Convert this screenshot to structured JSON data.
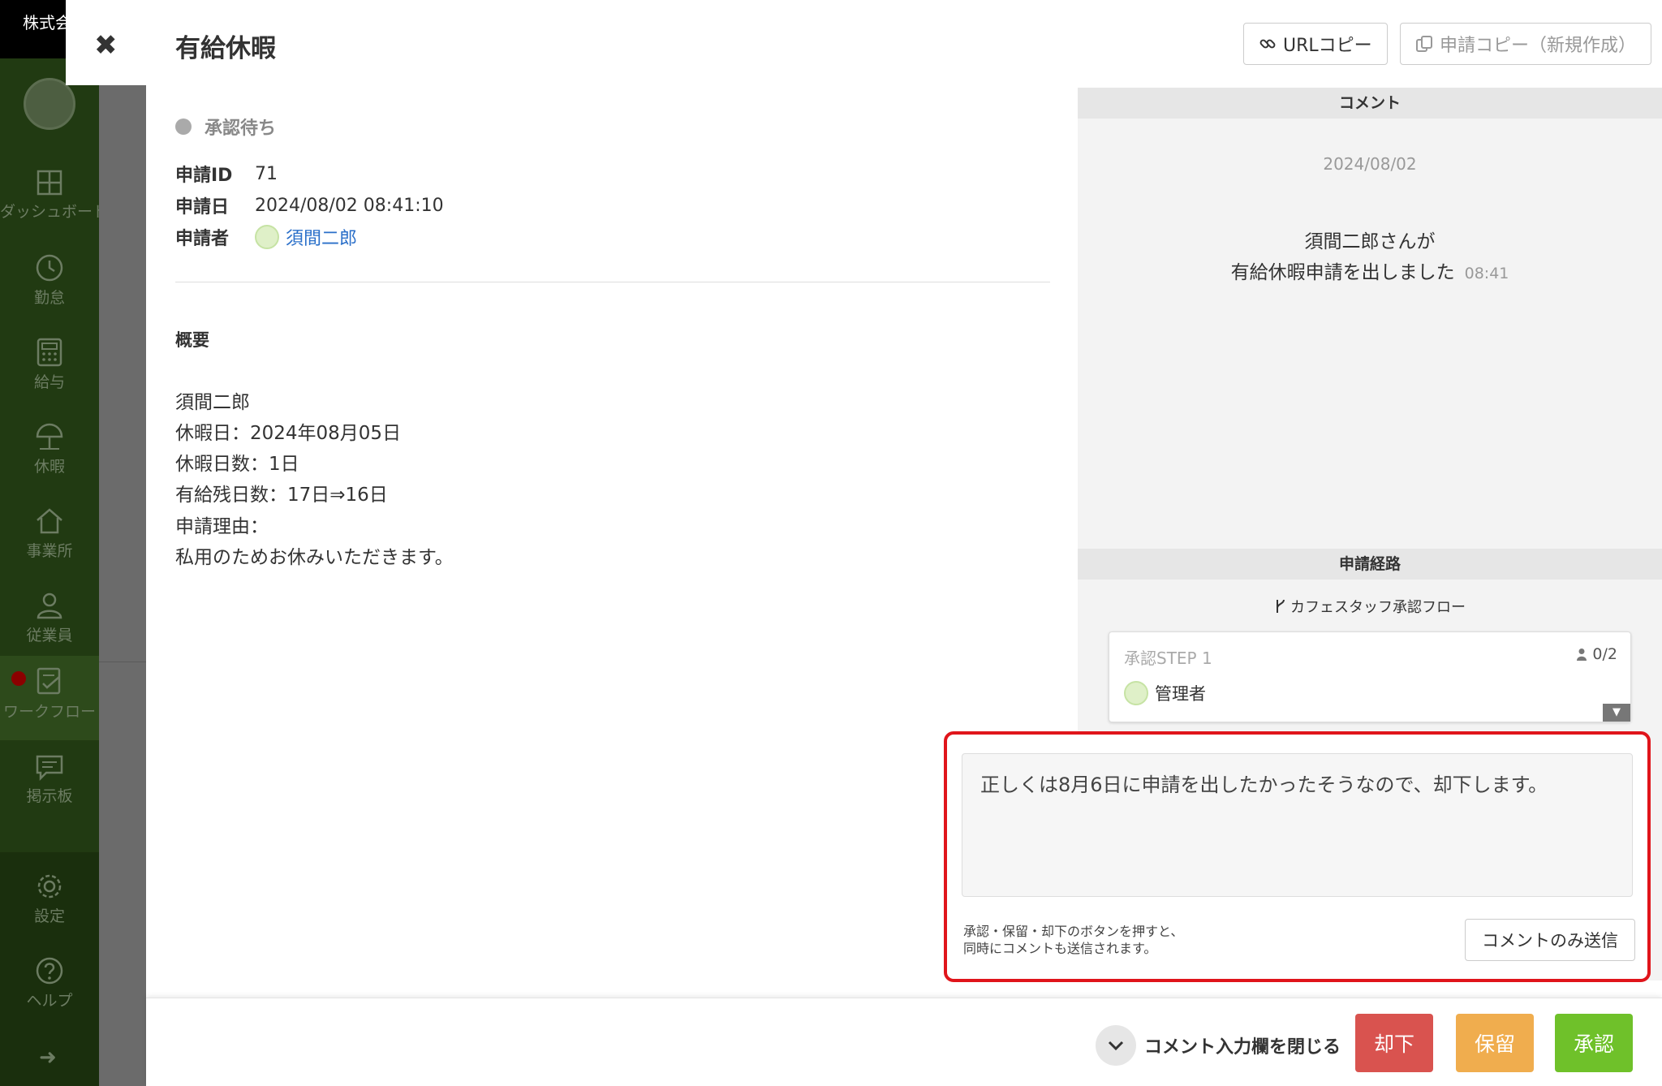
{
  "sidebar": {
    "company": "株式会",
    "items": [
      {
        "label": "ダッシュボード",
        "icon": "dashboard-icon"
      },
      {
        "label": "勤怠",
        "icon": "clock-icon"
      },
      {
        "label": "給与",
        "icon": "calculator-icon"
      },
      {
        "label": "休暇",
        "icon": "umbrella-icon"
      },
      {
        "label": "事業所",
        "icon": "home-icon"
      },
      {
        "label": "従業員",
        "icon": "person-icon"
      },
      {
        "label": "ワークフロー",
        "icon": "checklist-icon"
      },
      {
        "label": "掲示板",
        "icon": "chat-icon"
      },
      {
        "label": "設定",
        "icon": "gear-icon"
      },
      {
        "label": "ヘルプ",
        "icon": "question-icon"
      }
    ],
    "expand_arrow": "➜"
  },
  "modal": {
    "close_glyph": "✖",
    "title": "有給休暇",
    "url_copy_label": "URLコピー",
    "request_copy_label": "申請コピー（新規作成）"
  },
  "detail": {
    "status": "承認待ち",
    "fields": [
      {
        "key": "申請ID",
        "value": "71"
      },
      {
        "key": "申請日",
        "value": "2024/08/02 08:41:10"
      },
      {
        "key": "申請者",
        "value": "須間二郎"
      }
    ],
    "summary_title": "概要",
    "summary_lines": [
      "須間二郎",
      "休暇日：2024年08月05日",
      "休暇日数：1日",
      "有給残日数：17日⇒16日",
      "申請理由：",
      "私用のためお休みいただきます。"
    ]
  },
  "comments": {
    "header": "コメント",
    "date": "2024/08/02",
    "line1": "須間二郎さんが",
    "line2": "有給休暇申請を出しました",
    "time": "08:41"
  },
  "route": {
    "header": "申請経路",
    "flow_name": "カフェスタッフ承認フロー",
    "step_title": "承認STEP 1",
    "step_count": "0/2",
    "approver": "管理者",
    "toggle_glyph": "▼"
  },
  "composer": {
    "text": "正しくは8月6日に申請を出したかったそうなので、却下します。",
    "note_line1": "承認・保留・却下のボタンを押すと、",
    "note_line2": "同時にコメントも送信されます。",
    "comment_only_label": "コメントのみ送信",
    "highlight_color": "#e0151b"
  },
  "footer": {
    "collapse_label": "コメント入力欄を閉じる",
    "reject_label": "却下",
    "hold_label": "保留",
    "approve_label": "承認",
    "colors": {
      "reject": "#d9534f",
      "hold": "#f0ad4e",
      "approve": "#6fc12a"
    }
  }
}
